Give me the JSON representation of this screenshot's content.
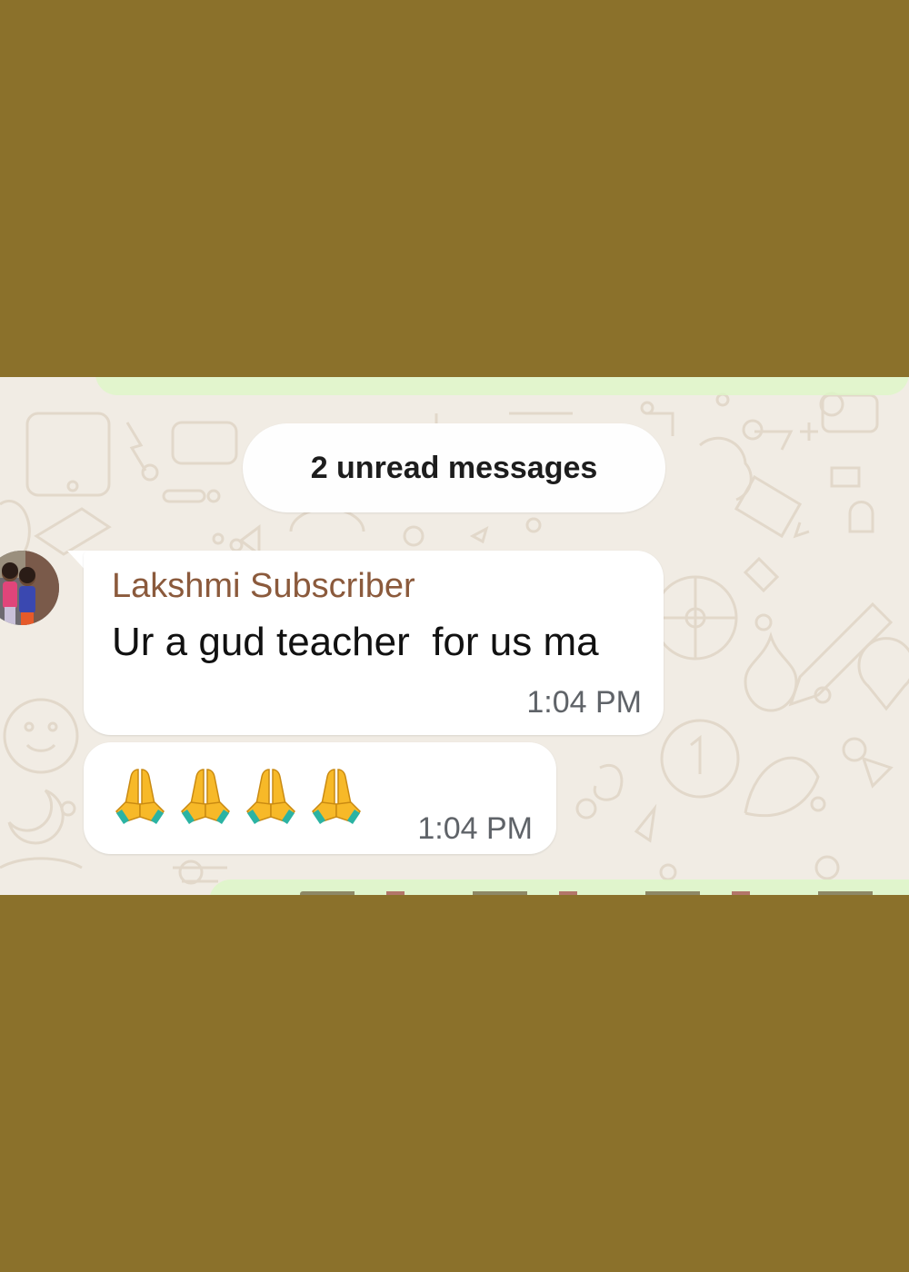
{
  "chat": {
    "unread_banner": "2 unread messages",
    "messages": [
      {
        "sender": "Lakshmi Subscriber",
        "text": "Ur a gud teacher  for us ma",
        "time": "1:04 PM"
      },
      {
        "emojis": [
          "folded-hands-icon",
          "folded-hands-icon",
          "folded-hands-icon",
          "folded-hands-icon"
        ],
        "time": "1:04 PM"
      }
    ]
  },
  "colors": {
    "frame_background": "#8b712b",
    "chat_background": "#f1ece4",
    "incoming_bubble": "#ffffff",
    "outgoing_bubble": "#dcf8c6",
    "sender_name": "#8b5a3c"
  }
}
